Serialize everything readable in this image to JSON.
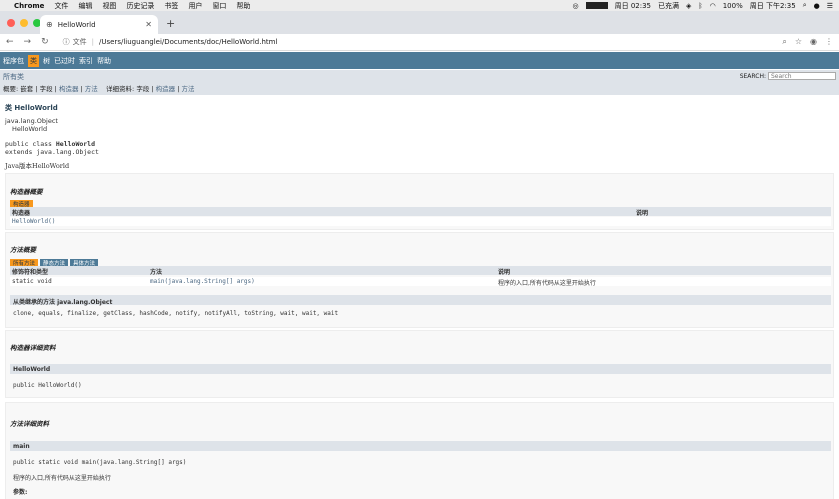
{
  "menubar": {
    "app": "Chrome",
    "items": [
      "文件",
      "编辑",
      "视图",
      "历史记录",
      "书签",
      "用户",
      "窗口",
      "帮助"
    ],
    "time_small": "周日 02:35",
    "battery_status": "已充满",
    "battery_pct": "100%",
    "clock": "周日 下午2:35"
  },
  "browser": {
    "tab_title": "HelloWorld",
    "url_scheme": "文件",
    "url": "/Users/liuguanglei/Documents/doc/HelloWorld.html"
  },
  "javadoc": {
    "nav": [
      "程序包",
      "类",
      "树",
      "已过时",
      "索引",
      "帮助"
    ],
    "all_classes": "所有类",
    "search_label": "SEARCH:",
    "search_placeholder": "Search",
    "summary": {
      "label": "概要:",
      "nested": "嵌套",
      "field": "字段",
      "constructor": "构造器",
      "method": "方法",
      "detail_label": "详细资料:",
      "d_field": "字段",
      "d_constructor": "构造器",
      "d_method": "方法"
    },
    "class_title": "类 HelloWorld",
    "inherit_parent": "java.lang.Object",
    "inherit_child": "HelloWorld",
    "decl_line1_a": "public class ",
    "decl_line1_b": "HelloWorld",
    "decl_line2": "extends java.lang.Object",
    "description": "Java版本HelloWorld",
    "constructor_summary": {
      "heading": "构造器概要",
      "tab": "构造器",
      "col1": "构造器",
      "col2": "说明",
      "row": "HelloWorld()"
    },
    "method_summary": {
      "heading": "方法概要",
      "tabs": [
        "所有方法",
        "静态方法",
        "具体方法"
      ],
      "col1": "修饰符和类型",
      "col2": "方法",
      "col3": "说明",
      "row_mod": "static void",
      "row_method": "main(java.lang.String[] args)",
      "row_desc": "程序的入口,所有代码从这里开始执行",
      "inherited_head": "从类继承的方法 java.lang.Object",
      "inherited_list": "clone, equals, finalize, getClass, hashCode, notify, notifyAll, toString, wait, wait, wait"
    },
    "constructor_detail": {
      "heading": "构造器详细资料",
      "name": "HelloWorld",
      "signature": "public HelloWorld()"
    },
    "method_detail": {
      "heading": "方法详细资料",
      "name": "main",
      "signature": "public static void main(java.lang.String[] args)",
      "desc": "程序的入口,所有代码从这里开始执行",
      "params_label": "参数:"
    }
  }
}
